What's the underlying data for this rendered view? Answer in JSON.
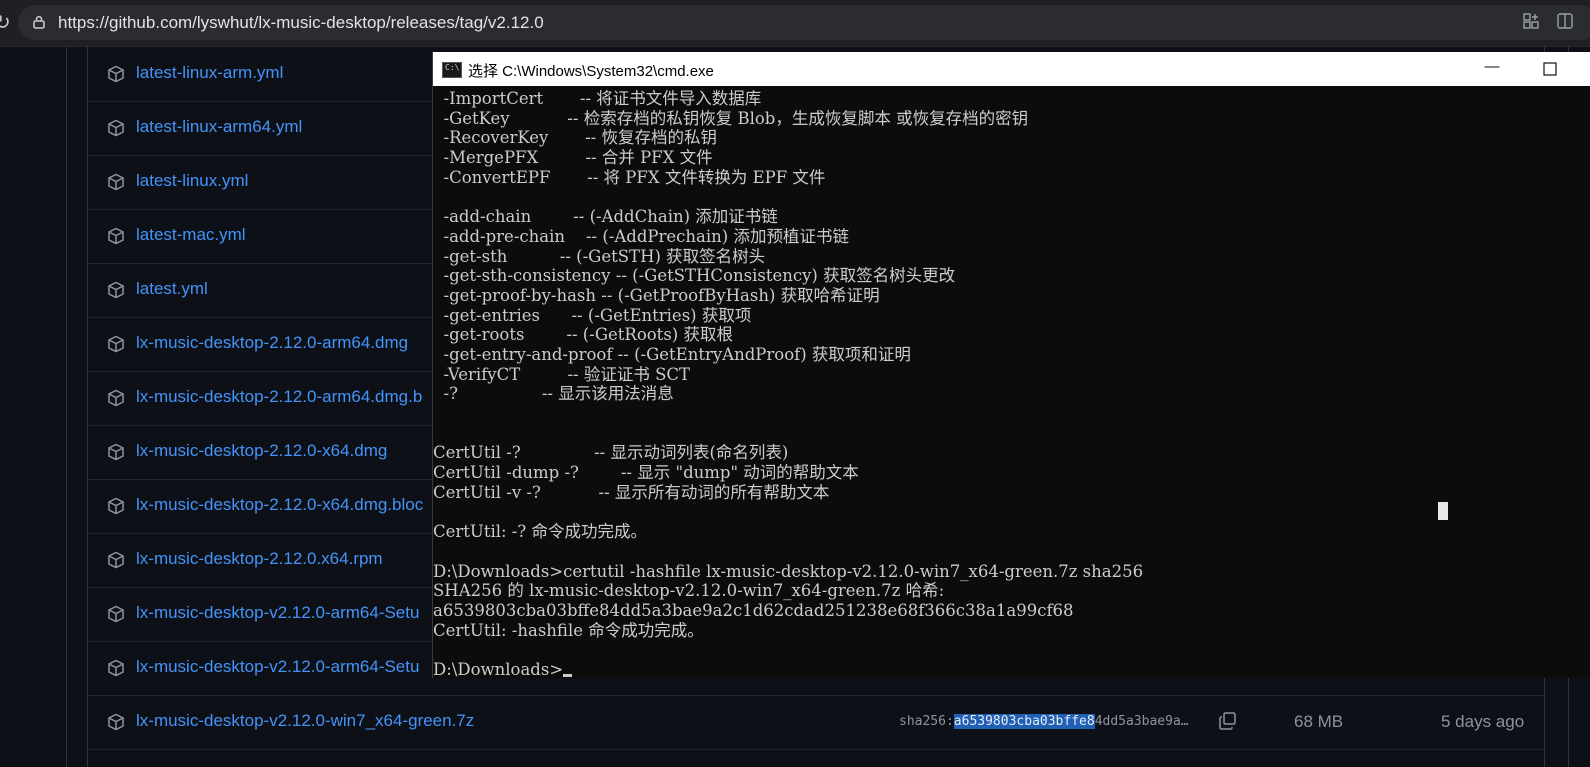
{
  "browser": {
    "url": "https://github.com/lyswhut/lx-music-desktop/releases/tag/v2.12.0"
  },
  "assets": [
    {
      "name": "latest-linux-arm.yml"
    },
    {
      "name": "latest-linux-arm64.yml"
    },
    {
      "name": "latest-linux.yml"
    },
    {
      "name": "latest-mac.yml"
    },
    {
      "name": "latest.yml"
    },
    {
      "name": "lx-music-desktop-2.12.0-arm64.dmg"
    },
    {
      "name": "lx-music-desktop-2.12.0-arm64.dmg.b"
    },
    {
      "name": "lx-music-desktop-2.12.0-x64.dmg"
    },
    {
      "name": "lx-music-desktop-2.12.0-x64.dmg.bloc"
    },
    {
      "name": "lx-music-desktop-2.12.0.x64.rpm"
    },
    {
      "name": "lx-music-desktop-v2.12.0-arm64-Setu"
    },
    {
      "name": "lx-music-desktop-v2.12.0-arm64-Setu"
    },
    {
      "name": "lx-music-desktop-v2.12.0-win7_x64-green.7z",
      "sha_prefix": "sha256:",
      "sha_selected": "a6539803cba03bffe8",
      "sha_rest": "4dd5a3bae9a…",
      "size": "68 MB",
      "date": "5 days ago"
    }
  ],
  "cmd": {
    "title": "选择 C:\\Windows\\System32\\cmd.exe",
    "lines": [
      "  -ImportCert       -- 将证书文件导入数据库",
      "  -GetKey           -- 检索存档的私钥恢复 Blob，生成恢复脚本 或恢复存档的密钥",
      "  -RecoverKey       -- 恢复存档的私钥",
      "  -MergePFX         -- 合并 PFX 文件",
      "  -ConvertEPF       -- 将 PFX 文件转换为 EPF 文件",
      "",
      "  -add-chain        -- (-AddChain) 添加证书链",
      "  -add-pre-chain    -- (-AddPrechain) 添加预植证书链",
      "  -get-sth          -- (-GetSTH) 获取签名树头",
      "  -get-sth-consistency -- (-GetSTHConsistency) 获取签名树头更改",
      "  -get-proof-by-hash -- (-GetProofByHash) 获取哈希证明",
      "  -get-entries      -- (-GetEntries) 获取项",
      "  -get-roots        -- (-GetRoots) 获取根",
      "  -get-entry-and-proof -- (-GetEntryAndProof) 获取项和证明",
      "  -VerifyCT         -- 验证证书 SCT",
      "  -?                -- 显示该用法消息",
      "",
      "",
      "CertUtil -?              -- 显示动词列表(命名列表)",
      "CertUtil -dump -?        -- 显示 \"dump\" 动词的帮助文本",
      "CertUtil -v -?           -- 显示所有动词的所有帮助文本",
      "",
      "CertUtil: -? 命令成功完成。",
      "",
      "D:\\Downloads>certutil -hashfile lx-music-desktop-v2.12.0-win7_x64-green.7z sha256",
      "SHA256 的 lx-music-desktop-v2.12.0-win7_x64-green.7z 哈希:",
      "a6539803cba03bffe84dd5a3bae9a2c1d62cdad251238e68f366c38a1a99cf68",
      "CertUtil: -hashfile 命令成功完成。",
      ""
    ],
    "prompt": "D:\\Downloads>"
  },
  "icons": {
    "lock": "lock-icon",
    "package": "package-icon",
    "copy": "copy-icon",
    "minimize": "minimize-icon",
    "maximize": "maximize-icon"
  }
}
